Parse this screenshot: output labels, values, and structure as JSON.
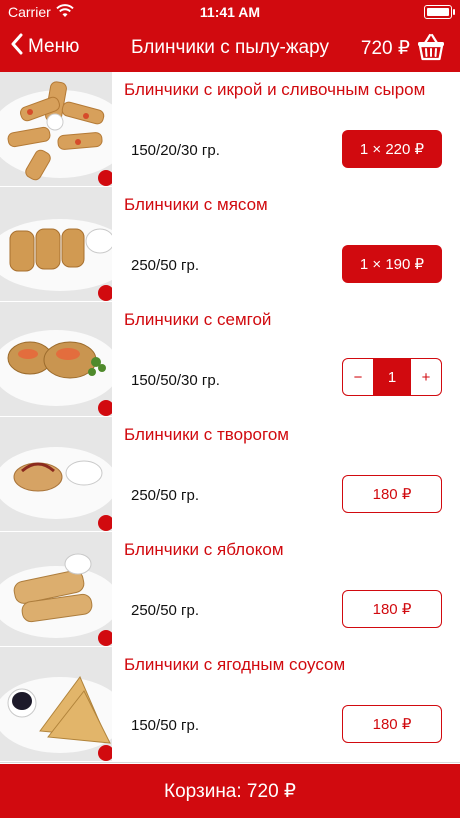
{
  "status_bar": {
    "carrier": "Carrier",
    "time": "11:41 AM"
  },
  "nav": {
    "back_label": "Меню",
    "title": "Блинчики с пылу-жару",
    "total": "720 ₽"
  },
  "items": [
    {
      "name": "Блинчики с икрой и сливочным сыром",
      "weight": "150/20/30 гр.",
      "button": "1 × 220 ₽",
      "state": "added"
    },
    {
      "name": "Блинчики с мясом",
      "weight": "250/50 гр.",
      "button": "1 × 190 ₽",
      "state": "added"
    },
    {
      "name": "Блинчики с семгой",
      "weight": "150/50/30 гр.",
      "stepper": {
        "minus": "−",
        "value": "1",
        "plus": "+"
      },
      "state": "stepper"
    },
    {
      "name": "Блинчики с творогом",
      "weight": "250/50 гр.",
      "button": "180 ₽",
      "state": "price"
    },
    {
      "name": "Блинчики с яблоком",
      "weight": "250/50 гр.",
      "button": "180 ₽",
      "state": "price"
    },
    {
      "name": "Блинчики с ягодным соусом",
      "weight": "150/50 гр.",
      "button": "180 ₽",
      "state": "price"
    }
  ],
  "bottom_bar": {
    "label": "Корзина: 720 ₽"
  },
  "colors": {
    "accent": "#d10a0f",
    "divider": "#d9d9d9"
  },
  "icons": {
    "back": "chevron-left-icon",
    "cart": "basket-icon",
    "wifi": "wifi-icon",
    "battery": "battery-icon"
  }
}
